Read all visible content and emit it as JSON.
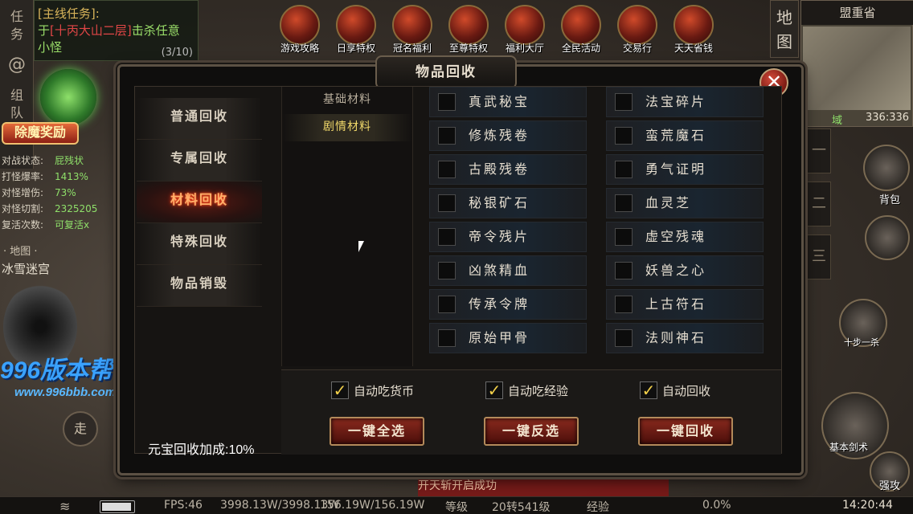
{
  "left_rail": {
    "task_label": "任\n务",
    "group_label": "组\n队"
  },
  "quest": {
    "title": "[主线任务]:",
    "line1_prefix": "于",
    "line1_place": "[十丙大山二层]",
    "line1_suffix": "击杀任意",
    "line2": "小怪",
    "progress": "(3/10)"
  },
  "reward": {
    "button_label": "除魔奖励"
  },
  "status": [
    {
      "label": "对战状态:",
      "value": "屁残状"
    },
    {
      "label": "打怪爆率:",
      "value": "1413%"
    },
    {
      "label": "对怪增伤:",
      "value": "73%"
    },
    {
      "label": "对怪切割:",
      "value": "2325205"
    },
    {
      "label": "复活次数:",
      "value": "可复活x"
    }
  ],
  "map": {
    "label": "· 地图 ·",
    "name": "冰雪迷宫"
  },
  "watermark": {
    "brand": "996版本帮",
    "url": "www.996bbb.com"
  },
  "walk_label": "走",
  "top_icons": [
    {
      "icon": "scroll-icon",
      "label": "游戏攻略"
    },
    {
      "icon": "dragon-icon",
      "label": "日享特权"
    },
    {
      "icon": "crown-icon",
      "label": "冠名福利"
    },
    {
      "icon": "helmet-icon",
      "label": "至尊特权"
    },
    {
      "icon": "gift-icon",
      "label": "福利大厅"
    },
    {
      "icon": "sword-icon",
      "label": "全民活动"
    },
    {
      "icon": "chest-icon",
      "label": "交易行"
    },
    {
      "icon": "coin-icon",
      "label": "天天省钱"
    }
  ],
  "minimap": {
    "button_label": "地\n图",
    "title": "盟重省",
    "zone": "域",
    "coords": "336:336"
  },
  "side_tabs": [
    "一",
    "二",
    "三"
  ],
  "right_buttons": {
    "bag": "背包",
    "skill": "基本剑术",
    "strong": "强攻",
    "step": "十步一杀"
  },
  "dialog": {
    "title": "物品回收",
    "close_label": "✕",
    "categories": [
      {
        "label": "普通回收",
        "active": false
      },
      {
        "label": "专属回收",
        "active": false
      },
      {
        "label": "材料回收",
        "active": true
      },
      {
        "label": "特殊回收",
        "active": false
      },
      {
        "label": "物品销毁",
        "active": false
      }
    ],
    "sub_tabs": [
      {
        "label": "基础材料",
        "active": false
      },
      {
        "label": "剧情材料",
        "active": true
      }
    ],
    "materials": [
      [
        "真武秘宝",
        "法宝碎片"
      ],
      [
        "修炼残卷",
        "蛮荒魔石"
      ],
      [
        "古殿残卷",
        "勇气证明"
      ],
      [
        "秘银矿石",
        "血灵芝"
      ],
      [
        "帝令残片",
        "虚空残魂"
      ],
      [
        "凶煞精血",
        "妖兽之心"
      ],
      [
        "传承令牌",
        "上古符石"
      ],
      [
        "原始甲骨",
        "法则神石"
      ]
    ],
    "options": [
      {
        "label": "自动吃货币",
        "checked": true
      },
      {
        "label": "自动吃经验",
        "checked": true
      },
      {
        "label": "自动回收",
        "checked": true
      }
    ],
    "actions": {
      "select_all": "一键全选",
      "invert": "一键反选",
      "recycle": "一键回收"
    },
    "bonus_text": "元宝回收加成:10%"
  },
  "system_messages": [
    "",
    "开天斩开启成功"
  ],
  "bottom_bar": {
    "fps": "FPS:46",
    "hp_mp": "3998.13W/3998.13W",
    "mp": "156.19W/156.19W",
    "level_label": "等级",
    "level": "20转541级",
    "exp_label": "经验",
    "exp": "0.0%",
    "time": "14:20:44"
  }
}
